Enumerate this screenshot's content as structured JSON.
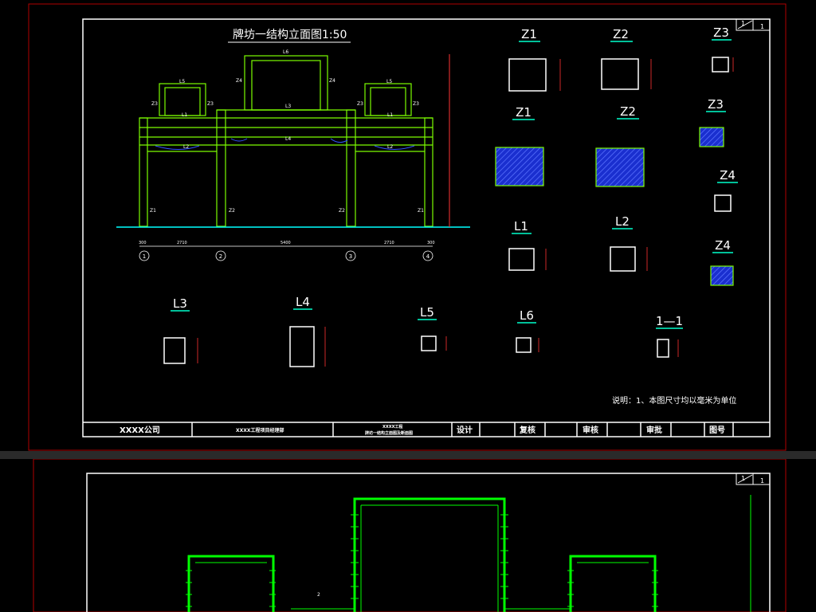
{
  "sheet1": {
    "main_title": "牌坊一结构立面图1:50",
    "sheet_number": {
      "top": "1",
      "bottom": "1"
    },
    "elevation_labels": {
      "top_beam": "L6",
      "side_beam_left": "L5",
      "side_beam_right": "L5",
      "z4_left": "Z4",
      "z4_right": "Z4",
      "z3_a": "Z3",
      "z3_b": "Z3",
      "z3_c": "Z3",
      "z3_d": "Z3",
      "l1_left": "L1",
      "l1_right": "L1",
      "l3": "L3",
      "l4": "L4",
      "l2_left": "L2",
      "l2_right": "L2",
      "z1_left": "Z1",
      "z1_right": "Z1",
      "z2_left": "Z2",
      "z2_right": "Z2"
    },
    "axes": [
      "1",
      "2",
      "3",
      "4"
    ],
    "dims": {
      "span_side_left": "2710",
      "span_mid": "5400",
      "span_side_right": "2710",
      "end_left": "300",
      "end_right": "300"
    },
    "sections": {
      "z1_top": "Z1",
      "z2_top": "Z2",
      "z3_top": "Z3",
      "z1_mid": "Z1",
      "z2_mid": "Z2",
      "z3_mid": "Z3",
      "z4_a": "Z4",
      "z4_b": "Z4",
      "l1": "L1",
      "l2": "L2",
      "l3": "L3",
      "l4": "L4",
      "l5": "L5",
      "l6": "L6",
      "s11": "1—1"
    },
    "note": "说明：1、本图尺寸均以毫米为单位",
    "title_block": {
      "company": "XXXX公司",
      "project": "XXXX工程项目经理部",
      "drawing_line1": "XXXX工程",
      "drawing_line2": "牌坊一结构立面图及断面图",
      "design": "设计",
      "check": "复核",
      "review": "审核",
      "approve": "审批",
      "drawing_no": "图号"
    }
  },
  "sheet2": {
    "sheet_number": {
      "top": "1",
      "bottom": "1"
    },
    "marker": "2"
  },
  "colors": {
    "background": "#000000",
    "frame_red": "#b00000",
    "line_green": "#00ff00",
    "text_white": "#ffffff",
    "hatch_blue": "#1e3cff"
  }
}
